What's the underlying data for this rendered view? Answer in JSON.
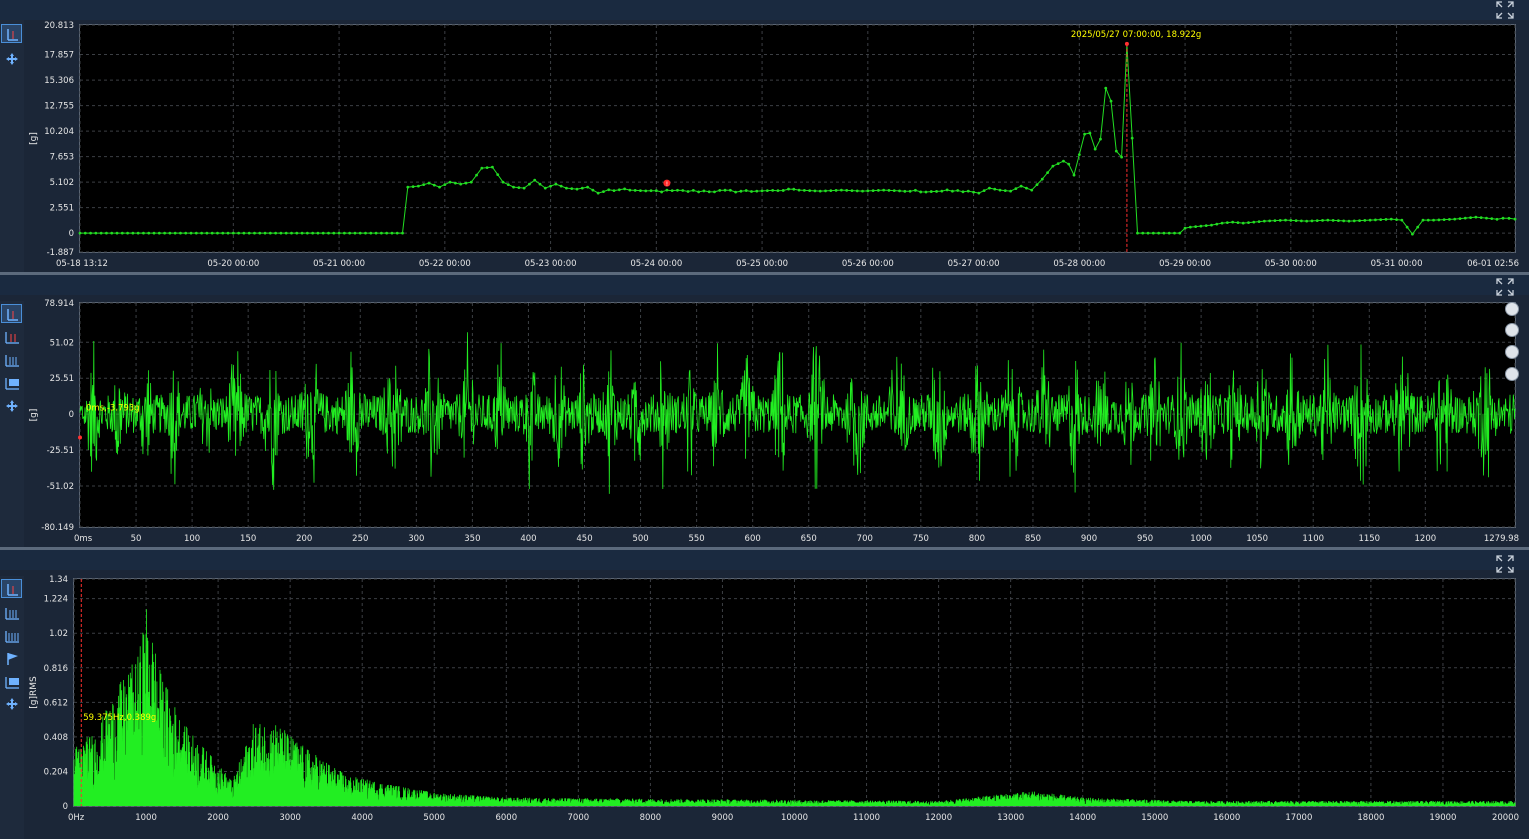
{
  "chart_data": [
    {
      "type": "line",
      "panel": "trend",
      "ylabel": "[g]",
      "yticks": [
        "20.813",
        "17.857",
        "15.306",
        "12.755",
        "10.204",
        "7.653",
        "5.102",
        "2.551",
        "0",
        "-1.887"
      ],
      "ylim": [
        -1.887,
        20.813
      ],
      "xticks": [
        "05-18 13:12",
        "05-20 00:00",
        "05-21 00:00",
        "05-22 00:00",
        "05-23 00:00",
        "05-24 00:00",
        "05-25 00:00",
        "05-26 00:00",
        "05-27 00:00",
        "05-28 00:00",
        "05-29 00:00",
        "05-30 00:00",
        "05-31 00:00",
        "06-01 02:56"
      ],
      "x_unit": "days since 05-18 13:12",
      "xlim": [
        0,
        13.57
      ],
      "series": [
        {
          "color": "#22dd22",
          "points": [
            [
              0,
              0
            ],
            [
              3.0,
              0
            ],
            [
              3.05,
              0
            ],
            [
              3.1,
              4.6
            ],
            [
              3.2,
              4.7
            ],
            [
              3.3,
              5.0
            ],
            [
              3.4,
              4.6
            ],
            [
              3.5,
              5.1
            ],
            [
              3.6,
              4.9
            ],
            [
              3.7,
              5.1
            ],
            [
              3.8,
              6.5
            ],
            [
              3.9,
              6.6
            ],
            [
              4.0,
              5.1
            ],
            [
              4.1,
              4.6
            ],
            [
              4.2,
              4.5
            ],
            [
              4.3,
              5.3
            ],
            [
              4.4,
              4.5
            ],
            [
              4.5,
              4.9
            ],
            [
              4.6,
              4.5
            ],
            [
              4.7,
              4.4
            ],
            [
              4.8,
              4.6
            ],
            [
              4.9,
              4.0
            ],
            [
              5.0,
              4.3
            ],
            [
              5.2,
              4.3
            ],
            [
              5.4,
              4.2
            ],
            [
              5.6,
              4.2
            ],
            [
              5.8,
              4.2
            ],
            [
              6.0,
              4.2
            ],
            [
              6.2,
              4.2
            ],
            [
              6.4,
              4.2
            ],
            [
              6.6,
              4.3
            ],
            [
              6.8,
              4.3
            ],
            [
              7.0,
              4.2
            ],
            [
              7.2,
              4.3
            ],
            [
              7.4,
              4.2
            ],
            [
              7.6,
              4.3
            ],
            [
              7.8,
              4.2
            ],
            [
              8.0,
              4.2
            ],
            [
              8.2,
              4.2
            ],
            [
              8.4,
              4.2
            ],
            [
              8.5,
              4.0
            ],
            [
              8.6,
              4.5
            ],
            [
              8.7,
              4.3
            ],
            [
              8.8,
              4.2
            ],
            [
              8.9,
              4.7
            ],
            [
              9.0,
              4.3
            ],
            [
              9.1,
              5.4
            ],
            [
              9.2,
              6.7
            ],
            [
              9.3,
              7.2
            ],
            [
              9.35,
              6.9
            ],
            [
              9.4,
              5.8
            ],
            [
              9.5,
              9.9
            ],
            [
              9.55,
              10.0
            ],
            [
              9.6,
              8.4
            ],
            [
              9.65,
              9.4
            ],
            [
              9.7,
              14.5
            ],
            [
              9.75,
              13.2
            ],
            [
              9.8,
              8.2
            ],
            [
              9.85,
              7.6
            ],
            [
              9.9,
              18.9
            ],
            [
              9.95,
              9.5
            ],
            [
              10.0,
              0
            ],
            [
              10.1,
              0
            ],
            [
              10.2,
              0
            ],
            [
              10.3,
              0
            ],
            [
              10.4,
              0
            ],
            [
              10.45,
              0.5
            ],
            [
              10.5,
              0.6
            ],
            [
              10.6,
              0.7
            ],
            [
              10.7,
              0.8
            ],
            [
              10.8,
              1.0
            ],
            [
              10.9,
              1.1
            ],
            [
              11.0,
              1.0
            ],
            [
              11.2,
              1.2
            ],
            [
              11.4,
              1.3
            ],
            [
              11.6,
              1.2
            ],
            [
              11.8,
              1.3
            ],
            [
              12.0,
              1.2
            ],
            [
              12.2,
              1.3
            ],
            [
              12.4,
              1.4
            ],
            [
              12.5,
              1.3
            ],
            [
              12.6,
              -0.1
            ],
            [
              12.7,
              1.3
            ],
            [
              12.8,
              1.3
            ],
            [
              13.0,
              1.4
            ],
            [
              13.2,
              1.6
            ],
            [
              13.4,
              1.4
            ],
            [
              13.57,
              1.4
            ]
          ]
        }
      ],
      "annotation": {
        "label": "2025/05/27 07:00:00, 18.922g",
        "x": 9.9,
        "y": 18.922,
        "color": "#ffff00"
      },
      "marker": {
        "x": 5.55,
        "y": 5.0,
        "label": "!"
      }
    },
    {
      "type": "line",
      "panel": "waveform",
      "ylabel": "[g]",
      "yticks": [
        "78.914",
        "51.02",
        "25.51",
        "0",
        "-25.51",
        "-51.02",
        "-80.149"
      ],
      "ylim": [
        -80.149,
        78.914
      ],
      "xticks": [
        "0ms",
        "50",
        "100",
        "150",
        "200",
        "250",
        "300",
        "350",
        "400",
        "450",
        "500",
        "550",
        "600",
        "650",
        "700",
        "750",
        "800",
        "850",
        "900",
        "950",
        "1000",
        "1050",
        "1100",
        "1150",
        "1200",
        "1279.98"
      ],
      "xlim": [
        0,
        1279.98
      ],
      "series": [
        {
          "color": "#22ee22",
          "envelope": "noise",
          "amplitude_rms": 15,
          "peak": 65
        }
      ],
      "annotation": {
        "label": "0ms,-3.793g",
        "x": 0,
        "y": -3.793,
        "color": "#ffff00"
      }
    },
    {
      "type": "line",
      "panel": "spectrum",
      "ylabel": "[g]RMS",
      "yticks": [
        "1.34",
        "1.224",
        "1.02",
        "0.816",
        "0.612",
        "0.408",
        "0.204",
        "0"
      ],
      "ylim": [
        0,
        1.34
      ],
      "xticks": [
        "0Hz",
        "1000",
        "2000",
        "3000",
        "4000",
        "5000",
        "6000",
        "7000",
        "8000",
        "9000",
        "10000",
        "11000",
        "12000",
        "13000",
        "14000",
        "15000",
        "16000",
        "17000",
        "18000",
        "19000",
        "20000"
      ],
      "xlim": [
        0,
        20000
      ],
      "series": [
        {
          "color": "#22ee22",
          "envelope_points": [
            [
              0,
              0.35
            ],
            [
              300,
              0.45
            ],
            [
              600,
              0.7
            ],
            [
              900,
              0.9
            ],
            [
              1000,
              1.2
            ],
            [
              1200,
              0.8
            ],
            [
              1500,
              0.5
            ],
            [
              2000,
              0.25
            ],
            [
              2200,
              0.15
            ],
            [
              2500,
              0.5
            ],
            [
              2800,
              0.5
            ],
            [
              3200,
              0.35
            ],
            [
              3800,
              0.18
            ],
            [
              4500,
              0.12
            ],
            [
              5000,
              0.08
            ],
            [
              6000,
              0.05
            ],
            [
              9000,
              0.04
            ],
            [
              12000,
              0.03
            ],
            [
              13300,
              0.09
            ],
            [
              14000,
              0.05
            ],
            [
              15500,
              0.03
            ],
            [
              20000,
              0.03
            ]
          ]
        }
      ],
      "annotation": {
        "label": "59.375Hz,0.389g",
        "x": 59.375,
        "y": 0.389,
        "color": "#ffff00"
      }
    }
  ]
}
